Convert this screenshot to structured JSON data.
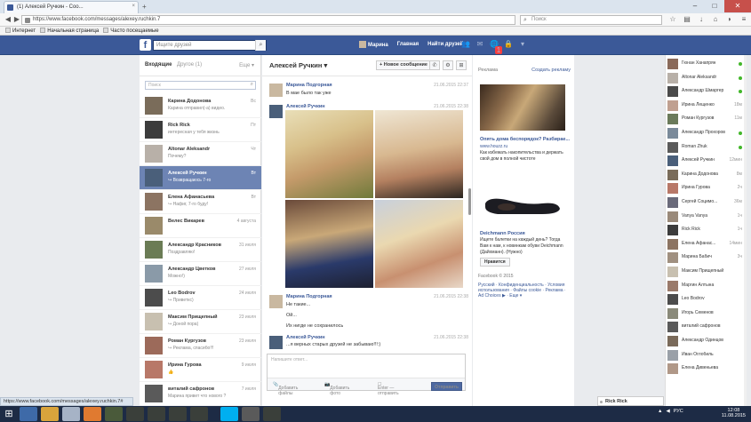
{
  "browser": {
    "tab_title": "(1) Алексей Ручкин - Соо...",
    "url": "https://www.facebook.com/messages/alexey.ruchkin.7",
    "search_placeholder": "Поиск",
    "bookmarks": [
      "Интернет",
      "Начальная страница",
      "Часто посещаемые"
    ],
    "status_url": "https://www.facebook.com/messages/alexey.ruchkin.7#"
  },
  "fb": {
    "logo": "f",
    "search_placeholder": "Ищите друзей",
    "nav": [
      "Марина",
      "Главная",
      "Найти друзей"
    ],
    "notif_badge": "1"
  },
  "left": {
    "tab_inbox": "Входящие",
    "tab_other": "Другое (1)",
    "more": "Еще ▾",
    "search_placeholder": "Поиск",
    "conversations": [
      {
        "name": "Карина Додонова",
        "snippet": "Карина отправил(-а) видео.",
        "time": "Вс",
        "color": "#7a6c5a"
      },
      {
        "name": "Rick Rick",
        "snippet": "интересная у тебя жизнь",
        "time": "Пт",
        "color": "#3c3c3c"
      },
      {
        "name": "Altonar Aleksandr",
        "snippet": "Почему?",
        "time": "Чт",
        "color": "#b8b0a8"
      },
      {
        "name": "Алексей Ручкин",
        "snippet": "↪ Возвращаюсь 7-го",
        "time": "Вт",
        "color": "#4a5f7a"
      },
      {
        "name": "Елена Афанасьева",
        "snippet": "↪ Нафиг, 7-го буду!",
        "time": "Вт",
        "color": "#8c7462"
      },
      {
        "name": "Велес Викарев",
        "snippet": "",
        "time": "4 августа",
        "color": "#9a8a6a"
      },
      {
        "name": "Александр Красников",
        "snippet": "Поздравляю!",
        "time": "31 июля",
        "color": "#6b7c55"
      },
      {
        "name": "Александр Цветков",
        "snippet": "Можно!)",
        "time": "27 июля",
        "color": "#8a9aa8"
      },
      {
        "name": "Leo Bodrov",
        "snippet": "↪ Приветкс)",
        "time": "24 июля",
        "color": "#4c4c4c"
      },
      {
        "name": "Максим Прищепный",
        "snippet": "↪ Доной пора)",
        "time": "23 июля",
        "color": "#c8c0b0"
      },
      {
        "name": "Роман Кургузов",
        "snippet": "↪ Реклама, спасибо!!!",
        "time": "23 июля",
        "color": "#9c6a5a"
      },
      {
        "name": "Ирина Гурова",
        "snippet": "👍",
        "time": "9 июля",
        "color": "#b87868"
      },
      {
        "name": "виталий сафронов",
        "snippet": "Марина привет что нового ?",
        "time": "7 июля",
        "color": "#5a5a5a"
      }
    ]
  },
  "conversation": {
    "title": "Алексей Ручкин",
    "title_caret": "▾",
    "new_message": "+ Новое сообщение",
    "messages": [
      {
        "from": "Марина Подгорная",
        "time": "21.06.2015 22:37",
        "lines": [
          "В мае было так уже"
        ]
      },
      {
        "from": "Алексей Ручкин",
        "time": "21.06.2015 22:38",
        "lines": []
      },
      {
        "from": "Марина Подгорная",
        "time": "21.06.2015 22:38",
        "lines": [
          "Не такие...",
          "Ой...",
          "Их нигде не сохранилось"
        ]
      },
      {
        "from": "Алексей Ручкин",
        "time": "21.06.2015 22:38",
        "lines": [
          "...я верных старых друзей не забываю!!!:)"
        ]
      }
    ],
    "composer_placeholder": "Напишите ответ...",
    "add_files": "Добавить файлы",
    "add_photo": "Добавить фото",
    "enter_hint": "Enter — отправить",
    "send": "Отправить"
  },
  "ads": {
    "header": "Реклама",
    "create": "Создать рекламу",
    "ad1_title": "Опять дома беспорядок? Разбирае...",
    "ad1_site": "www.houzz.ru",
    "ad1_desc": "Как избежать накопительства и держать свой дом в полной чистоте",
    "ad2_title": "Deichmann Россия",
    "ad2_desc": "Ищете балетки на каждый день? Тогда Вам к нам, к новинкам обуви Deichmann (Дайхманн). (Нужно)",
    "like": "Нравится",
    "copyright": "Facebook © 2015",
    "footer_links": "Русский · Конфиденциальность · Условия использования · Файлы cookie · Реклама · Ad Choices ▶ · Еще ▾"
  },
  "friends": [
    {
      "name": "Гюнан Ханапрян",
      "status": "dot"
    },
    {
      "name": "Altonar Aleksandr",
      "status": "dot"
    },
    {
      "name": "Александр Шмаргер",
      "status": "dot"
    },
    {
      "name": "Ирина Лещенко",
      "status": "18м"
    },
    {
      "name": "Роман Кургузов",
      "status": "11м"
    },
    {
      "name": "Александр Прохоров",
      "status": "dot"
    },
    {
      "name": "Roman Zhuk",
      "status": "dot"
    },
    {
      "name": "Алексей Ручкин",
      "status": "12мин"
    },
    {
      "name": "Карина Додонова",
      "status": "8м"
    },
    {
      "name": "Ирина Гурова",
      "status": "2ч"
    },
    {
      "name": "Сергей Социмо...",
      "status": "36м"
    },
    {
      "name": "Vanya Vanya",
      "status": "1ч"
    },
    {
      "name": "Rick Rick",
      "status": "1ч"
    },
    {
      "name": "Елена Афанас...",
      "status": "14мин"
    },
    {
      "name": "Марина Бабич",
      "status": "3ч"
    },
    {
      "name": "Максим Прищепный",
      "status": ""
    },
    {
      "name": "Маргин Алтына",
      "status": ""
    },
    {
      "name": "Leo Bodrov",
      "status": ""
    },
    {
      "name": "Игорь Семенов",
      "status": ""
    },
    {
      "name": "виталий сафронов",
      "status": ""
    },
    {
      "name": "Александр Одинцов",
      "status": ""
    },
    {
      "name": "Иван Оглобиль",
      "status": ""
    },
    {
      "name": "Елена Дивеньева",
      "status": ""
    }
  ],
  "chat_pill": "Rick Rick",
  "taskbar": {
    "tray": "РУС",
    "time": "12:08",
    "date": "11.08.2015"
  }
}
